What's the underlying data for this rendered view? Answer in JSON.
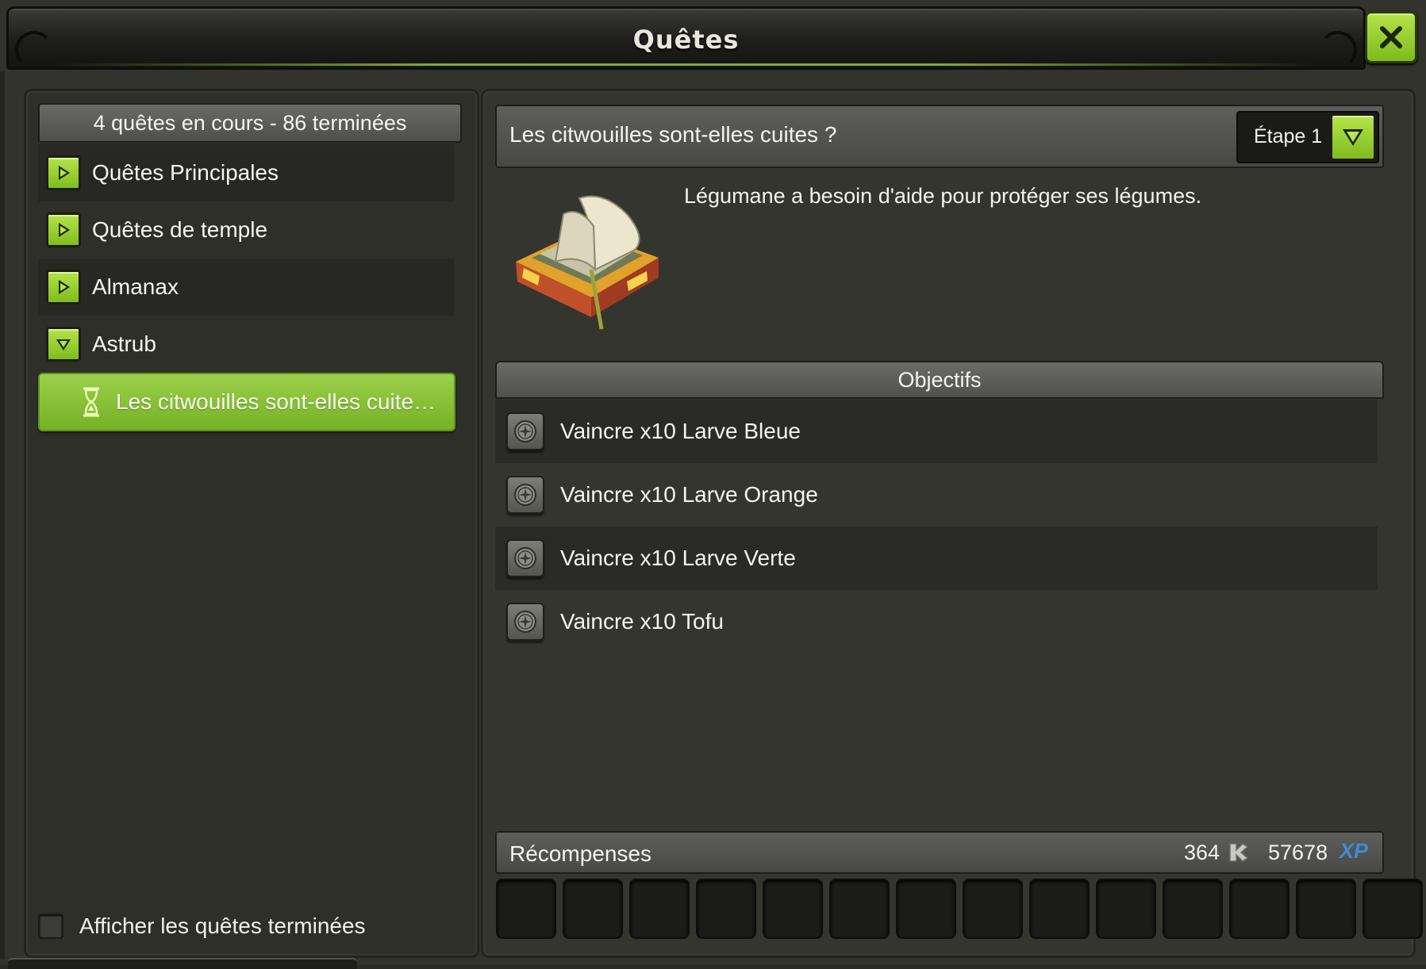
{
  "window": {
    "title": "Quêtes",
    "close_icon": "close-icon"
  },
  "left": {
    "summary": "4 quêtes en cours - 86 terminées",
    "categories": [
      {
        "label": "Quêtes Principales",
        "state": "collapsed",
        "icon": "play-right-icon"
      },
      {
        "label": "Quêtes de temple",
        "state": "collapsed",
        "icon": "play-right-icon"
      },
      {
        "label": "Almanax",
        "state": "collapsed",
        "icon": "play-right-icon"
      },
      {
        "label": "Astrub",
        "state": "expanded",
        "icon": "chevron-down-icon"
      }
    ],
    "selected_quest": {
      "label": "Les citwouilles sont-elles cuite…",
      "icon": "hourglass-icon"
    },
    "show_completed_label": "Afficher les quêtes terminées",
    "show_completed_checked": false
  },
  "right": {
    "quest_title": "Les citwouilles sont-elles cuites ?",
    "step_label": "Étape 1",
    "description": "Légumane a besoin d'aide pour protéger ses légumes.",
    "objectives_header": "Objectifs",
    "objectives": [
      "Vaincre x10 Larve Bleue",
      "Vaincre x10 Larve Orange",
      "Vaincre x10 Larve Verte",
      "Vaincre x10 Tofu"
    ],
    "rewards": {
      "label": "Récompenses",
      "kamas": "364",
      "xp": "57678",
      "xp_tag": "XP"
    },
    "reward_slot_count": 14
  },
  "colors": {
    "accent_green": "#8ccb2f",
    "xp_blue": "#3f8bd8",
    "panel_dark": "#2f2f2a"
  }
}
